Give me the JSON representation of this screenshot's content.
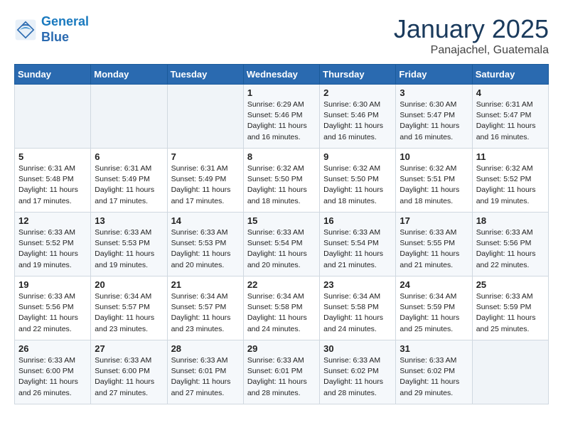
{
  "header": {
    "logo_line1": "General",
    "logo_line2": "Blue",
    "month": "January 2025",
    "location": "Panajachel, Guatemala"
  },
  "days_of_week": [
    "Sunday",
    "Monday",
    "Tuesday",
    "Wednesday",
    "Thursday",
    "Friday",
    "Saturday"
  ],
  "weeks": [
    [
      {
        "day": "",
        "info": ""
      },
      {
        "day": "",
        "info": ""
      },
      {
        "day": "",
        "info": ""
      },
      {
        "day": "1",
        "info": "Sunrise: 6:29 AM\nSunset: 5:46 PM\nDaylight: 11 hours and 16 minutes."
      },
      {
        "day": "2",
        "info": "Sunrise: 6:30 AM\nSunset: 5:46 PM\nDaylight: 11 hours and 16 minutes."
      },
      {
        "day": "3",
        "info": "Sunrise: 6:30 AM\nSunset: 5:47 PM\nDaylight: 11 hours and 16 minutes."
      },
      {
        "day": "4",
        "info": "Sunrise: 6:31 AM\nSunset: 5:47 PM\nDaylight: 11 hours and 16 minutes."
      }
    ],
    [
      {
        "day": "5",
        "info": "Sunrise: 6:31 AM\nSunset: 5:48 PM\nDaylight: 11 hours and 17 minutes."
      },
      {
        "day": "6",
        "info": "Sunrise: 6:31 AM\nSunset: 5:49 PM\nDaylight: 11 hours and 17 minutes."
      },
      {
        "day": "7",
        "info": "Sunrise: 6:31 AM\nSunset: 5:49 PM\nDaylight: 11 hours and 17 minutes."
      },
      {
        "day": "8",
        "info": "Sunrise: 6:32 AM\nSunset: 5:50 PM\nDaylight: 11 hours and 18 minutes."
      },
      {
        "day": "9",
        "info": "Sunrise: 6:32 AM\nSunset: 5:50 PM\nDaylight: 11 hours and 18 minutes."
      },
      {
        "day": "10",
        "info": "Sunrise: 6:32 AM\nSunset: 5:51 PM\nDaylight: 11 hours and 18 minutes."
      },
      {
        "day": "11",
        "info": "Sunrise: 6:32 AM\nSunset: 5:52 PM\nDaylight: 11 hours and 19 minutes."
      }
    ],
    [
      {
        "day": "12",
        "info": "Sunrise: 6:33 AM\nSunset: 5:52 PM\nDaylight: 11 hours and 19 minutes."
      },
      {
        "day": "13",
        "info": "Sunrise: 6:33 AM\nSunset: 5:53 PM\nDaylight: 11 hours and 19 minutes."
      },
      {
        "day": "14",
        "info": "Sunrise: 6:33 AM\nSunset: 5:53 PM\nDaylight: 11 hours and 20 minutes."
      },
      {
        "day": "15",
        "info": "Sunrise: 6:33 AM\nSunset: 5:54 PM\nDaylight: 11 hours and 20 minutes."
      },
      {
        "day": "16",
        "info": "Sunrise: 6:33 AM\nSunset: 5:54 PM\nDaylight: 11 hours and 21 minutes."
      },
      {
        "day": "17",
        "info": "Sunrise: 6:33 AM\nSunset: 5:55 PM\nDaylight: 11 hours and 21 minutes."
      },
      {
        "day": "18",
        "info": "Sunrise: 6:33 AM\nSunset: 5:56 PM\nDaylight: 11 hours and 22 minutes."
      }
    ],
    [
      {
        "day": "19",
        "info": "Sunrise: 6:33 AM\nSunset: 5:56 PM\nDaylight: 11 hours and 22 minutes."
      },
      {
        "day": "20",
        "info": "Sunrise: 6:34 AM\nSunset: 5:57 PM\nDaylight: 11 hours and 23 minutes."
      },
      {
        "day": "21",
        "info": "Sunrise: 6:34 AM\nSunset: 5:57 PM\nDaylight: 11 hours and 23 minutes."
      },
      {
        "day": "22",
        "info": "Sunrise: 6:34 AM\nSunset: 5:58 PM\nDaylight: 11 hours and 24 minutes."
      },
      {
        "day": "23",
        "info": "Sunrise: 6:34 AM\nSunset: 5:58 PM\nDaylight: 11 hours and 24 minutes."
      },
      {
        "day": "24",
        "info": "Sunrise: 6:34 AM\nSunset: 5:59 PM\nDaylight: 11 hours and 25 minutes."
      },
      {
        "day": "25",
        "info": "Sunrise: 6:33 AM\nSunset: 5:59 PM\nDaylight: 11 hours and 25 minutes."
      }
    ],
    [
      {
        "day": "26",
        "info": "Sunrise: 6:33 AM\nSunset: 6:00 PM\nDaylight: 11 hours and 26 minutes."
      },
      {
        "day": "27",
        "info": "Sunrise: 6:33 AM\nSunset: 6:00 PM\nDaylight: 11 hours and 27 minutes."
      },
      {
        "day": "28",
        "info": "Sunrise: 6:33 AM\nSunset: 6:01 PM\nDaylight: 11 hours and 27 minutes."
      },
      {
        "day": "29",
        "info": "Sunrise: 6:33 AM\nSunset: 6:01 PM\nDaylight: 11 hours and 28 minutes."
      },
      {
        "day": "30",
        "info": "Sunrise: 6:33 AM\nSunset: 6:02 PM\nDaylight: 11 hours and 28 minutes."
      },
      {
        "day": "31",
        "info": "Sunrise: 6:33 AM\nSunset: 6:02 PM\nDaylight: 11 hours and 29 minutes."
      },
      {
        "day": "",
        "info": ""
      }
    ]
  ]
}
